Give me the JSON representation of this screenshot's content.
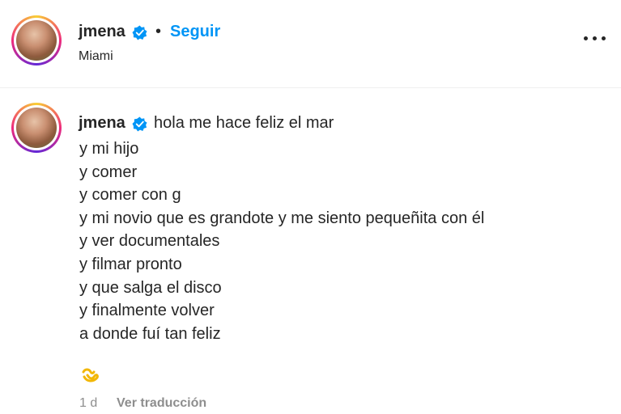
{
  "header": {
    "username": "jmena",
    "separator": "•",
    "follow_label": "Seguir",
    "location": "Miami",
    "more_icon": "more-options-icon"
  },
  "caption": {
    "username": "jmena",
    "first_line": "hola me hace feliz el mar",
    "lines": [
      "y mi hijo",
      "y comer",
      "y comer con g",
      "y mi novio que es grandote y me siento pequeñita con él",
      "y ver documentales",
      "y filmar pronto",
      "y que salga el disco",
      "y finalmente volver",
      "a donde fuí tan feliz"
    ],
    "emoji_icon": "wave-emoji-icon"
  },
  "meta": {
    "time": "1 d",
    "translate_label": "Ver traducción"
  },
  "colors": {
    "accent": "#0095f6",
    "text": "#262626",
    "muted": "#8e8e8e",
    "verified": "#0095f6"
  }
}
